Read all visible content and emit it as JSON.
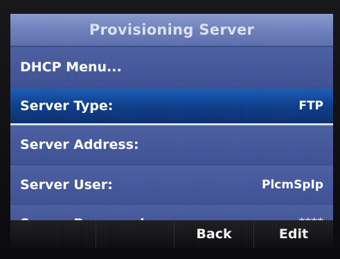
{
  "screen": {
    "title": "Provisioning Server"
  },
  "menu": {
    "items": [
      {
        "label": "DHCP Menu...",
        "value": ""
      },
      {
        "label": "Server Type:",
        "value": "FTP"
      },
      {
        "label": "Server Address:",
        "value": ""
      },
      {
        "label": "Server User:",
        "value": "PlcmSpIp"
      },
      {
        "label": "Server Password:",
        "value": "****"
      }
    ],
    "selected_index": 1
  },
  "softkeys": {
    "key1": "",
    "key2": "",
    "key3": "Back",
    "key4": "Edit"
  },
  "colors": {
    "screen_bg": "#3a4c8c",
    "title_bar": "#7a8cc4",
    "selection": "#0e3f8d",
    "softkey_bar": "#131316",
    "text": "#ffffff"
  }
}
